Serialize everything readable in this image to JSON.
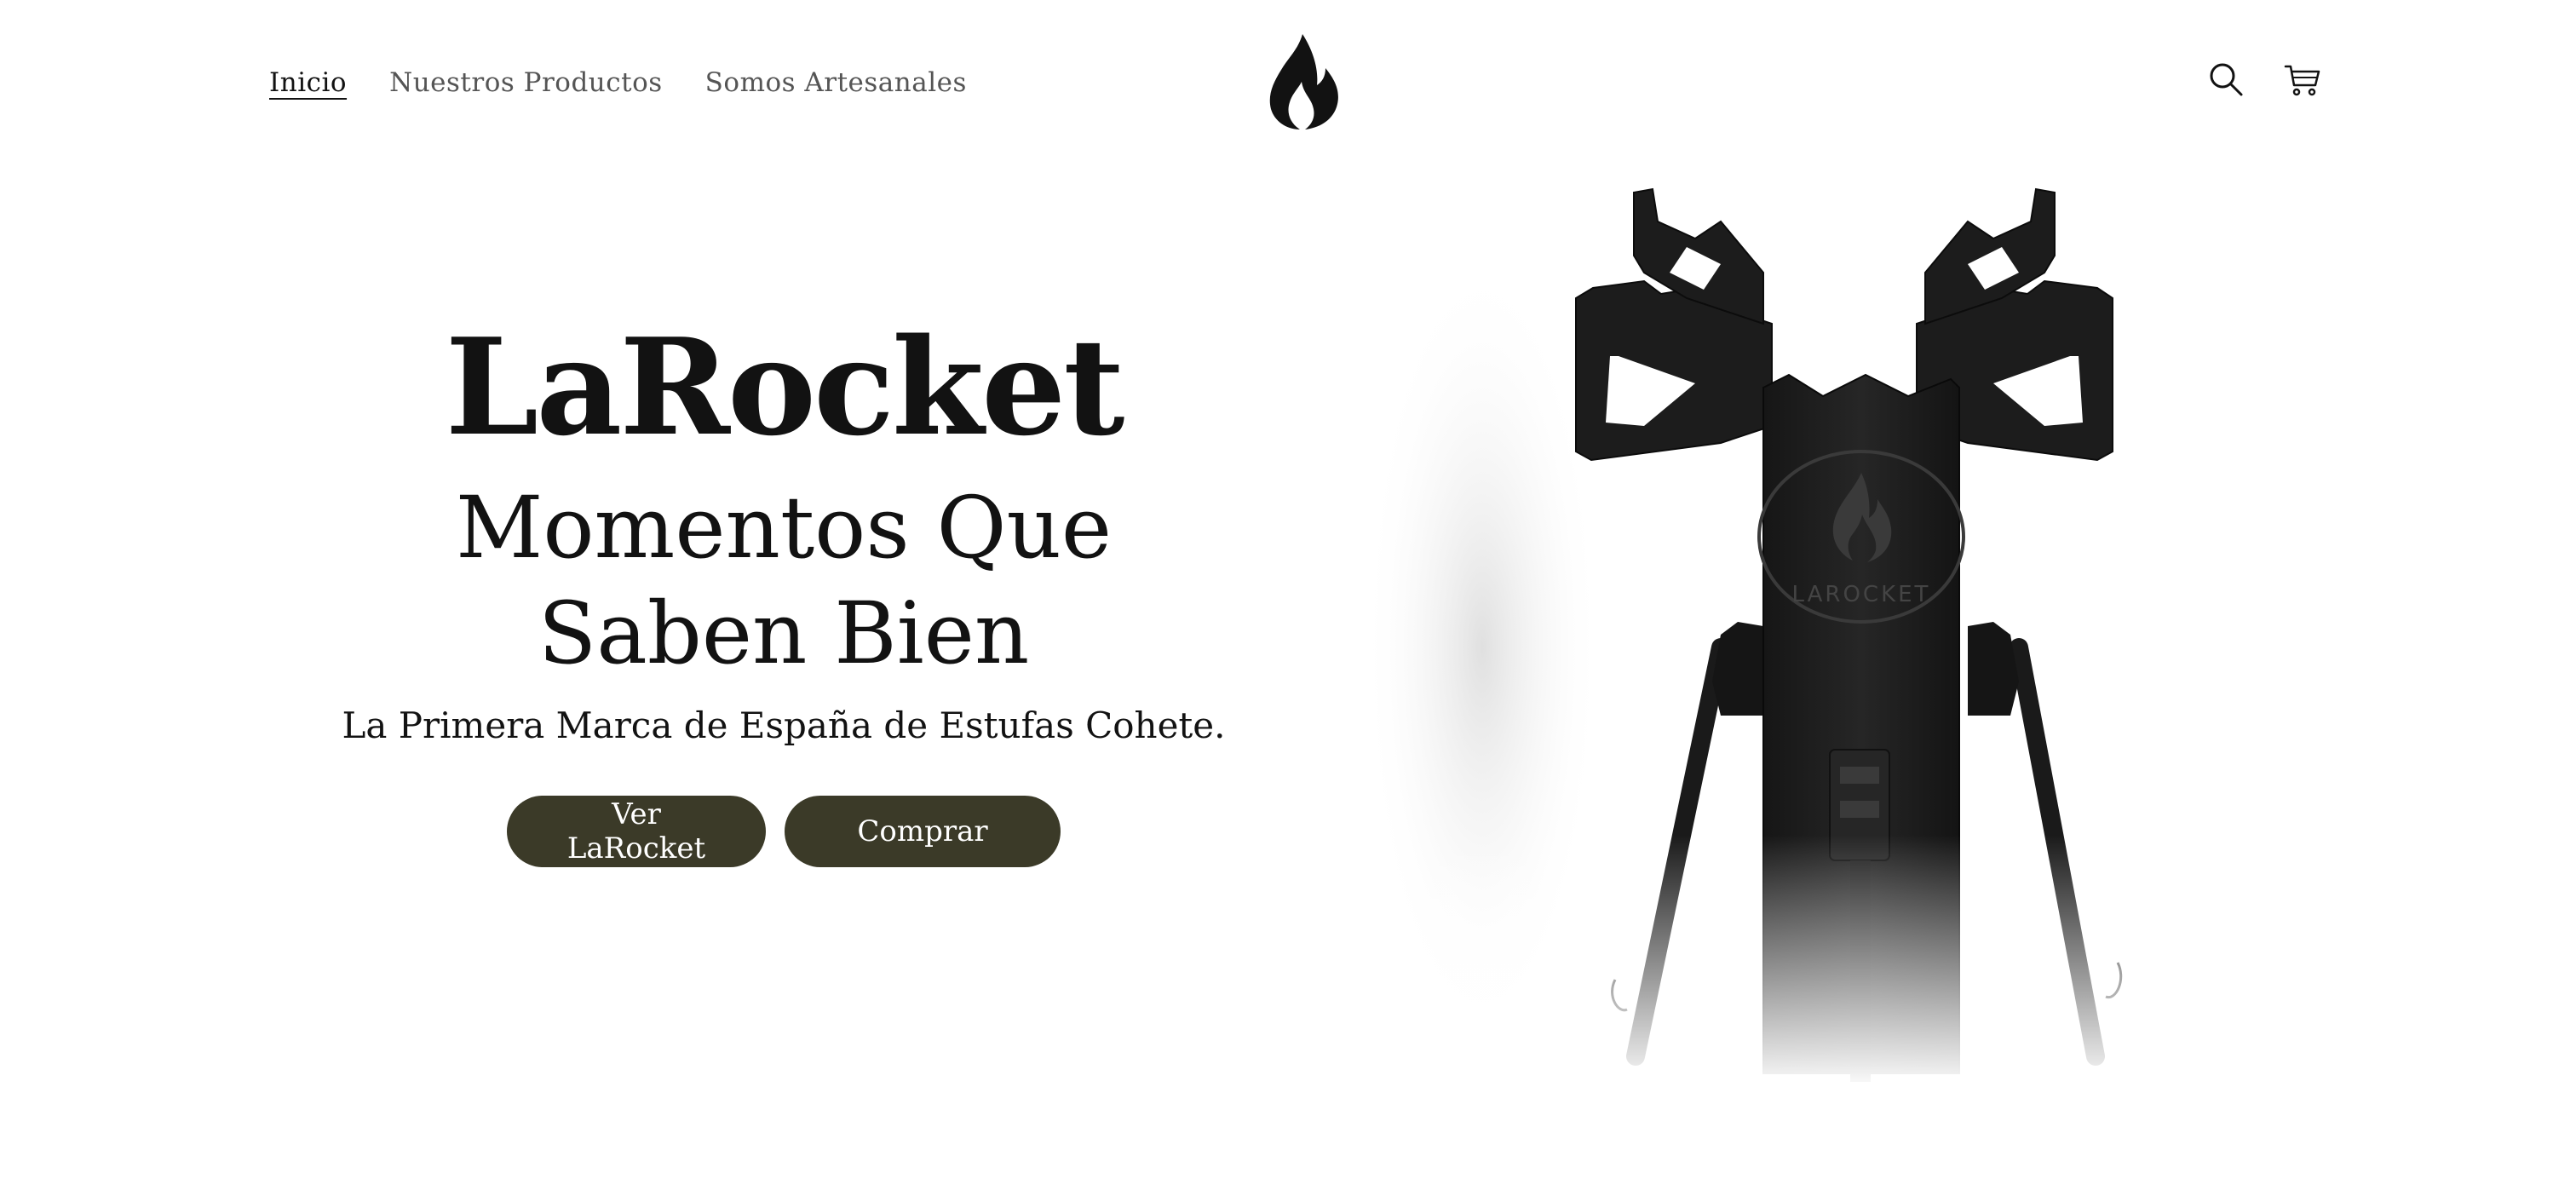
{
  "header": {
    "nav": [
      {
        "label": "Inicio",
        "active": true
      },
      {
        "label": "Nuestros Productos",
        "active": false
      },
      {
        "label": "Somos Artesanales",
        "active": false
      }
    ],
    "logo_icon": "flame-icon",
    "icons": [
      "search-icon",
      "cart-icon"
    ]
  },
  "hero": {
    "title": "LaRocket",
    "subtitle_line1": "Momentos Que",
    "subtitle_line2": "Saben Bien",
    "description": "La Primera Marca de España de Estufas Cohete.",
    "buttons": {
      "primary": "Ver LaRocket",
      "secondary": "Comprar"
    },
    "image_brand_mark": "LAROCKET"
  },
  "colors": {
    "button_bg": "#3b3a28",
    "text": "#121212",
    "nav_text": "#555555",
    "stove": "#1c1c1c"
  }
}
